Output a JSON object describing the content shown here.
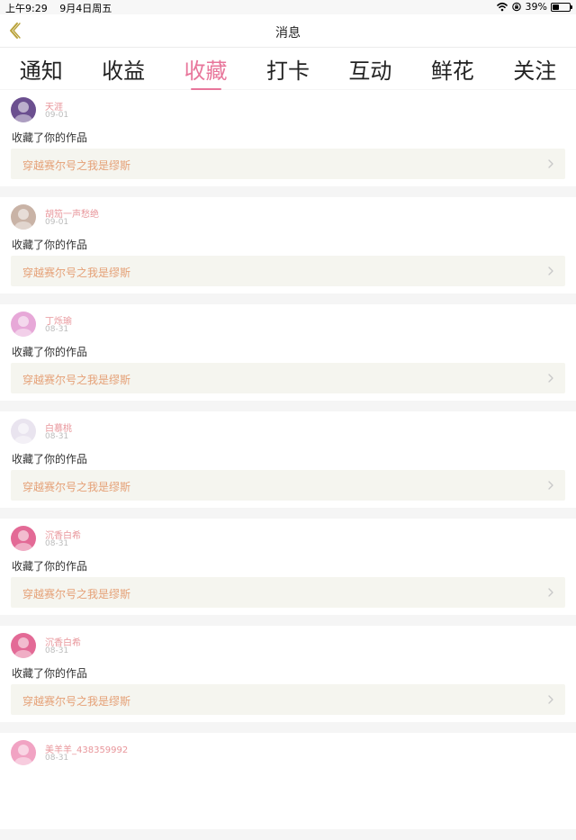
{
  "status_bar": {
    "time": "上午9:29",
    "date": "9月4日周五",
    "battery": "39%",
    "battery_level": 0.39,
    "icons": [
      "wifi-icon",
      "orientation-lock-icon",
      "battery-icon"
    ]
  },
  "header": {
    "title": "消息",
    "back_icon": "chevron-left-icon"
  },
  "tabs": [
    {
      "label": "通知",
      "active": false
    },
    {
      "label": "收益",
      "active": false
    },
    {
      "label": "收藏",
      "active": true
    },
    {
      "label": "打卡",
      "active": false
    },
    {
      "label": "互动",
      "active": false
    },
    {
      "label": "鲜花",
      "active": false
    },
    {
      "label": "关注",
      "active": false
    }
  ],
  "notifications": [
    {
      "user": "天涯",
      "date": "09-01",
      "action": "收藏了你的作品",
      "work": "穿越赛尔号之我是缪斯",
      "avatar_color": "#6b4f8f"
    },
    {
      "user": "胡笳一声愁绝",
      "date": "09-01",
      "action": "收藏了你的作品",
      "work": "穿越赛尔号之我是缪斯",
      "avatar_color": "#c9b3a6"
    },
    {
      "user": "丁烁瑜",
      "date": "08-31",
      "action": "收藏了你的作品",
      "work": "穿越赛尔号之我是缪斯",
      "avatar_color": "#e7a8d8"
    },
    {
      "user": "白慕桃",
      "date": "08-31",
      "action": "收藏了你的作品",
      "work": "穿越赛尔号之我是缪斯",
      "avatar_color": "#e9e4ef"
    },
    {
      "user": "沉香白希",
      "date": "08-31",
      "action": "收藏了你的作品",
      "work": "穿越赛尔号之我是缪斯",
      "avatar_color": "#e36a96"
    },
    {
      "user": "沉香白希",
      "date": "08-31",
      "action": "收藏了你的作品",
      "work": "穿越赛尔号之我是缪斯",
      "avatar_color": "#e36a96"
    },
    {
      "user": "美羊羊_438359992",
      "date": "08-31",
      "action": "",
      "work": "",
      "avatar_color": "#f1a3c3"
    }
  ],
  "colors": {
    "accent": "#e8769b",
    "username": "#e8969b",
    "work_title": "#e5a076",
    "work_bg": "#f5f5ef"
  }
}
